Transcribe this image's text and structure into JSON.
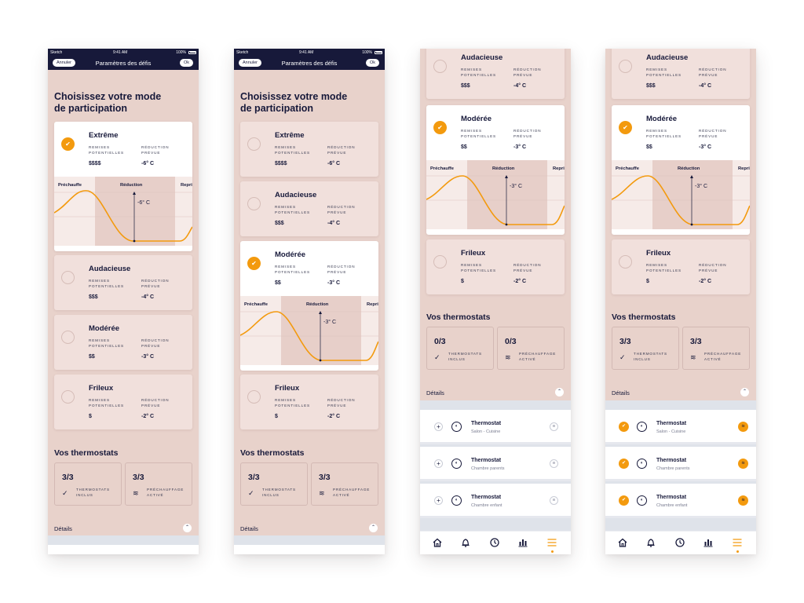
{
  "statusbar": {
    "carrier": "Sketch",
    "time": "9:41 AM",
    "battery": "100%"
  },
  "navbar": {
    "cancel": "Annuler",
    "title": "Paramètres des défis",
    "ok": "Ok"
  },
  "mode_heading": [
    "Choisissez votre mode",
    "de participation"
  ],
  "option_labels": {
    "rebates": [
      "REMISES",
      "POTENTIELLES"
    ],
    "reduction": [
      "RÉDUCTION",
      "PRÉVUE"
    ]
  },
  "options": [
    {
      "name": "Extrême",
      "rebate": "$$$$",
      "reduction": "-6° C"
    },
    {
      "name": "Audacieuse",
      "rebate": "$$$",
      "reduction": "-4° C"
    },
    {
      "name": "Modérée",
      "rebate": "$$",
      "reduction": "-3° C"
    },
    {
      "name": "Frileux",
      "rebate": "$",
      "reduction": "-2° C"
    }
  ],
  "graph_labels": {
    "preheat": "Préchauffe",
    "reduction": "Réduction",
    "recovery": "Repri"
  },
  "thermostats_section": {
    "title": "Vos thermostats",
    "included_label": [
      "THERMOSTATS",
      "INCLUS"
    ],
    "preheat_label": [
      "PRÉCHAUFFAGE",
      "ACTIVÉ"
    ],
    "details": "Détails"
  },
  "screens": [
    {
      "included": "3/3",
      "preheat": "3/3"
    },
    {
      "included": "3/3",
      "preheat": "3/3"
    },
    {
      "included": "0/3",
      "preheat": "0/3"
    },
    {
      "included": "3/3",
      "preheat": "3/3"
    }
  ],
  "thermostat_rows": [
    {
      "name": "Thermostat",
      "room": "Salon - Cuisine"
    },
    {
      "name": "Thermostat",
      "room": "Chambre parents"
    },
    {
      "name": "Thermostat",
      "room": "Chambre enfant"
    }
  ],
  "colors": {
    "accent": "#f39a0e",
    "navy": "#17193a",
    "background": "#e8d2cb",
    "card": "#f1e0dc"
  },
  "icons": {
    "tabs": [
      "home-icon",
      "bell-icon",
      "clock-icon",
      "bar-chart-icon",
      "menu-icon"
    ]
  }
}
